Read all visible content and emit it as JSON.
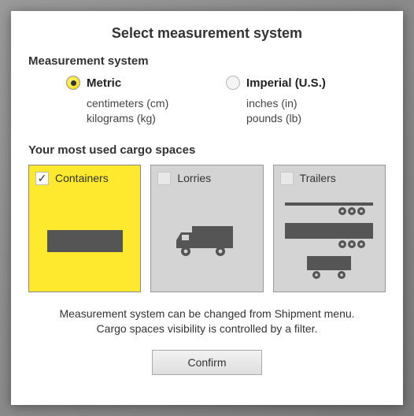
{
  "title": "Select measurement system",
  "measurement": {
    "label": "Measurement system",
    "options": {
      "metric": {
        "title": "Metric",
        "line1": "centimeters (cm)",
        "line2": "kilograms (kg)",
        "checked": true
      },
      "imperial": {
        "title": "Imperial (U.S.)",
        "line1": "inches (in)",
        "line2": "pounds (lb)",
        "checked": false
      }
    }
  },
  "cargo": {
    "label": "Your most used cargo spaces",
    "cards": {
      "containers": {
        "label": "Containers",
        "checked": true
      },
      "lorries": {
        "label": "Lorries",
        "checked": false
      },
      "trailers": {
        "label": "Trailers",
        "checked": false
      }
    }
  },
  "hint": {
    "line1": "Measurement system can be changed from Shipment menu.",
    "line2": "Cargo spaces visibility is controlled by a filter."
  },
  "confirm_label": "Confirm"
}
